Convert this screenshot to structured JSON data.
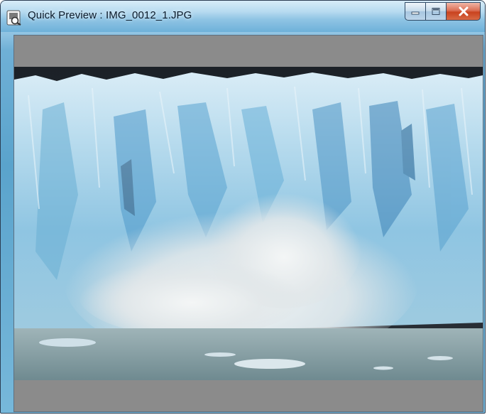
{
  "window": {
    "title": "Quick Preview : IMG_0012_1.JPG",
    "app_icon": "quick-preview-icon",
    "controls": {
      "minimize": "minimize-icon",
      "maximize": "maximize-icon",
      "close": "close-icon"
    }
  },
  "preview": {
    "image_subject": "glacier-calving-photo",
    "letterbox_color": "#8b8b8b"
  },
  "colors": {
    "titlebar_accent": "#6eb1d9",
    "close_button": "#c9431f"
  }
}
